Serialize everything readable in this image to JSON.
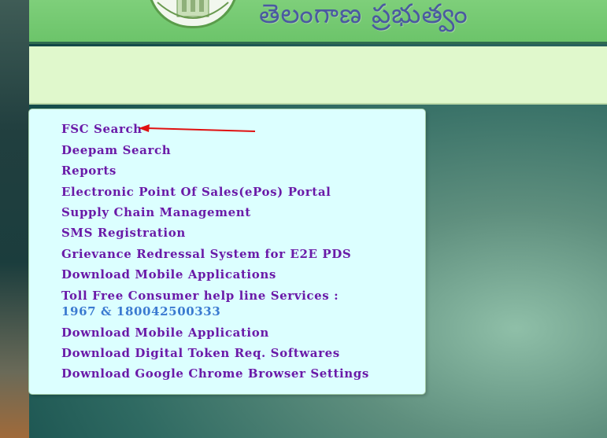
{
  "header": {
    "title": "తెలంగాణ ప్రభుత్వం",
    "emblem_icon": "telangana-emblem-icon"
  },
  "menu": {
    "items": [
      {
        "label": "FSC Search"
      },
      {
        "label": "Deepam Search"
      },
      {
        "label": "Reports"
      },
      {
        "label": "Electronic Point Of Sales(ePos) Portal"
      },
      {
        "label": "Supply Chain Management"
      },
      {
        "label": "SMS Registration"
      },
      {
        "label": "Grievance Redressal System for E2E PDS"
      },
      {
        "label": "Download Mobile Applications"
      },
      {
        "label": "Toll Free Consumer help line Services :",
        "numbers": "1967 & 180042500333"
      },
      {
        "label": "Download Mobile Application"
      },
      {
        "label": "Download Digital Token Req. Softwares"
      },
      {
        "label": "Download Google Chrome Browser Settings"
      }
    ]
  },
  "annotation": {
    "icon": "red-arrow-icon",
    "color": "#e01010"
  },
  "colors": {
    "link": "#6a1aa8",
    "number_highlight": "#3a7ad0",
    "panel": "#dcffff",
    "banner": "#6cc46a"
  }
}
